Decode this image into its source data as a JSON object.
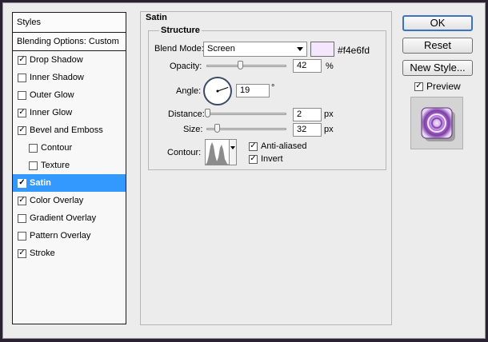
{
  "sidebar": {
    "header": "Styles",
    "blending": "Blending Options: Custom",
    "items": [
      {
        "label": "Drop Shadow",
        "checked": true,
        "selected": false,
        "indent": false
      },
      {
        "label": "Inner Shadow",
        "checked": false,
        "selected": false,
        "indent": false
      },
      {
        "label": "Outer Glow",
        "checked": false,
        "selected": false,
        "indent": false
      },
      {
        "label": "Inner Glow",
        "checked": true,
        "selected": false,
        "indent": false
      },
      {
        "label": "Bevel and Emboss",
        "checked": true,
        "selected": false,
        "indent": false
      },
      {
        "label": "Contour",
        "checked": false,
        "selected": false,
        "indent": true
      },
      {
        "label": "Texture",
        "checked": false,
        "selected": false,
        "indent": true
      },
      {
        "label": "Satin",
        "checked": true,
        "selected": true,
        "indent": false
      },
      {
        "label": "Color Overlay",
        "checked": true,
        "selected": false,
        "indent": false
      },
      {
        "label": "Gradient Overlay",
        "checked": false,
        "selected": false,
        "indent": false
      },
      {
        "label": "Pattern Overlay",
        "checked": false,
        "selected": false,
        "indent": false
      },
      {
        "label": "Stroke",
        "checked": true,
        "selected": false,
        "indent": false
      }
    ]
  },
  "panel": {
    "title": "Satin",
    "structure_title": "Structure",
    "blend_mode_label": "Blend Mode:",
    "blend_mode_value": "Screen",
    "color_hex": "#f4e6fd",
    "opacity_label": "Opacity:",
    "opacity_value": "42",
    "opacity_unit": "%",
    "opacity_fraction": 0.42,
    "angle_label": "Angle:",
    "angle_value": "19",
    "angle_unit": "°",
    "distance_label": "Distance:",
    "distance_value": "2",
    "distance_unit": "px",
    "distance_fraction": 0.01,
    "size_label": "Size:",
    "size_value": "32",
    "size_unit": "px",
    "size_fraction": 0.13,
    "contour_label": "Contour:",
    "anti_aliased_label": "Anti-aliased",
    "anti_aliased_checked": true,
    "invert_label": "Invert",
    "invert_checked": true
  },
  "actions": {
    "ok": "OK",
    "reset": "Reset",
    "new_style": "New Style...",
    "preview_label": "Preview",
    "preview_checked": true
  },
  "colors": {
    "selection": "#3399ff",
    "satin_color": "#f4e6fd",
    "preview_purple": "#9a5fc2"
  }
}
